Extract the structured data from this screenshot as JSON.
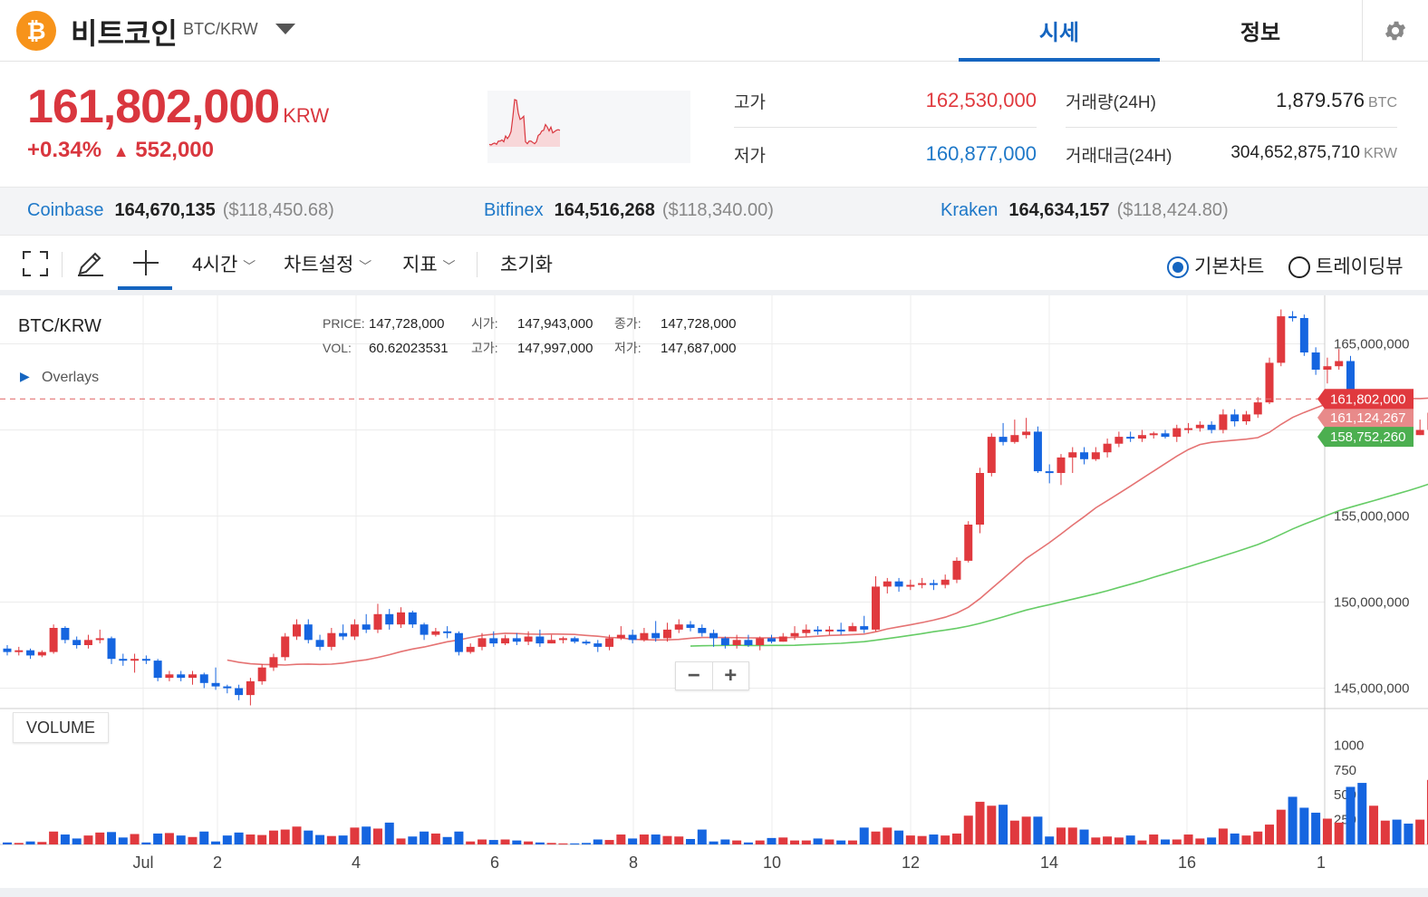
{
  "header": {
    "coin_symbol": "₿",
    "coin_name": "비트코인",
    "pair": "BTC/KRW",
    "tabs": [
      {
        "label": "시세",
        "active": true
      },
      {
        "label": "정보",
        "active": false
      }
    ]
  },
  "summary": {
    "price": "161,802,000",
    "price_unit": "KRW",
    "change_pct": "+0.34%",
    "change_abs": "552,000",
    "high_label": "고가",
    "high_value": "162,530,000",
    "low_label": "저가",
    "low_value": "160,877,000",
    "volume_label": "거래량(24H)",
    "volume_value": "1,879.576",
    "volume_unit": "BTC",
    "turnover_label": "거래대금(24H)",
    "turnover_value": "304,652,875,710",
    "turnover_unit": "KRW"
  },
  "exchanges": [
    {
      "name": "Coinbase",
      "krw": "164,670,135",
      "usd": "($118,450.68)"
    },
    {
      "name": "Bitfinex",
      "krw": "164,516,268",
      "usd": "($118,340.00)"
    },
    {
      "name": "Kraken",
      "krw": "164,634,157",
      "usd": "($118,424.80)"
    }
  ],
  "toolbar": {
    "interval": "4시간",
    "chart_settings": "차트설정",
    "indicators": "지표",
    "reset": "초기화",
    "basic_chart": "기본차트",
    "tradingview": "트레이딩뷰"
  },
  "colors": {
    "up": "#e0393e",
    "down": "#1565e0",
    "accent": "#1565c0",
    "ma_short": "#e57373",
    "ma_long": "#66cc66"
  },
  "chart_data": {
    "type": "candlestick",
    "pair_label": "BTC/KRW",
    "overlays_label": "Overlays",
    "info": {
      "price_label": "PRICE:",
      "price": "147,728,000",
      "open_label": "시가:",
      "open": "147,943,000",
      "close_label": "종가:",
      "close": "147,728,000",
      "vol_label": "VOL:",
      "vol": "60.62023531",
      "high_label": "고가:",
      "high": "147,997,000",
      "low_label": "저가:",
      "low": "147,687,000"
    },
    "x_ticks": [
      "Jul",
      "2",
      "4",
      "6",
      "8",
      "10",
      "12",
      "14",
      "16",
      "1"
    ],
    "y_ticks": [
      "165,000,000",
      "160,000,000",
      "155,000,000",
      "150,000,000",
      "145,000,000"
    ],
    "ylim": [
      143500000,
      167500000
    ],
    "current_price_label": "161,802,000",
    "ma_short_label": "161,124,267",
    "ma_long_label": "158,752,260",
    "volume_label": "VOLUME",
    "volume_ticks": [
      "1000",
      "750",
      "500",
      "250"
    ],
    "volume_ylim": [
      0,
      1150
    ],
    "candles": [
      [
        147300000,
        147100000,
        147500000,
        146900000,
        20
      ],
      [
        147100000,
        147200000,
        147400000,
        146900000,
        15
      ],
      [
        147200000,
        146900000,
        147300000,
        146700000,
        30
      ],
      [
        146900000,
        147100000,
        147200000,
        146800000,
        25
      ],
      [
        147100000,
        148500000,
        148700000,
        147000000,
        130
      ],
      [
        148500000,
        147800000,
        148600000,
        147600000,
        100
      ],
      [
        147800000,
        147500000,
        148000000,
        147300000,
        60
      ],
      [
        147500000,
        147800000,
        148100000,
        147300000,
        90
      ],
      [
        147800000,
        147900000,
        148400000,
        147600000,
        120
      ],
      [
        147900000,
        146700000,
        148000000,
        146400000,
        125
      ],
      [
        146700000,
        146600000,
        147000000,
        146300000,
        70
      ],
      [
        146600000,
        146700000,
        147000000,
        145900000,
        105
      ],
      [
        146700000,
        146600000,
        146900000,
        146400000,
        20
      ],
      [
        146600000,
        145600000,
        146700000,
        145400000,
        110
      ],
      [
        145600000,
        145800000,
        146000000,
        145400000,
        115
      ],
      [
        145800000,
        145600000,
        146000000,
        145400000,
        90
      ],
      [
        145600000,
        145800000,
        146000000,
        145200000,
        75
      ],
      [
        145800000,
        145300000,
        145900000,
        145000000,
        130
      ],
      [
        145300000,
        145100000,
        146200000,
        144900000,
        30
      ],
      [
        145100000,
        145000000,
        145200000,
        144700000,
        90
      ],
      [
        145000000,
        144600000,
        145200000,
        144300000,
        120
      ],
      [
        144600000,
        145400000,
        145600000,
        144000000,
        100
      ],
      [
        145400000,
        146200000,
        146400000,
        145200000,
        95
      ],
      [
        146200000,
        146800000,
        147000000,
        146000000,
        140
      ],
      [
        146800000,
        148000000,
        148200000,
        146600000,
        150
      ],
      [
        148000000,
        148700000,
        149000000,
        147800000,
        180
      ],
      [
        148700000,
        147800000,
        149000000,
        147600000,
        140
      ],
      [
        147800000,
        147400000,
        148100000,
        147200000,
        95
      ],
      [
        147400000,
        148200000,
        148500000,
        147200000,
        85
      ],
      [
        148200000,
        148000000,
        148700000,
        147800000,
        90
      ],
      [
        148000000,
        148700000,
        149000000,
        147800000,
        170
      ],
      [
        148700000,
        148400000,
        149300000,
        148200000,
        180
      ],
      [
        148400000,
        149300000,
        149900000,
        148200000,
        160
      ],
      [
        149300000,
        148700000,
        149600000,
        148400000,
        220
      ],
      [
        148700000,
        149400000,
        149700000,
        148500000,
        60
      ],
      [
        149400000,
        148700000,
        149500000,
        148500000,
        80
      ],
      [
        148700000,
        148100000,
        148800000,
        147800000,
        130
      ],
      [
        148100000,
        148300000,
        148500000,
        148000000,
        110
      ],
      [
        148300000,
        148200000,
        148600000,
        147900000,
        75
      ],
      [
        148200000,
        147100000,
        148300000,
        146900000,
        130
      ],
      [
        147100000,
        147400000,
        147600000,
        147000000,
        30
      ],
      [
        147400000,
        147900000,
        148200000,
        147200000,
        50
      ],
      [
        147900000,
        147600000,
        148300000,
        147400000,
        45
      ],
      [
        147600000,
        147900000,
        148100000,
        147500000,
        50
      ],
      [
        147900000,
        147700000,
        148200000,
        147500000,
        40
      ],
      [
        147700000,
        148000000,
        148300000,
        147500000,
        30
      ],
      [
        148000000,
        147600000,
        148400000,
        147400000,
        20
      ],
      [
        147600000,
        147800000,
        148100000,
        147600000,
        15
      ],
      [
        147800000,
        147900000,
        148000000,
        147600000,
        10
      ],
      [
        147900000,
        147700000,
        148000000,
        147600000,
        10
      ],
      [
        147700000,
        147600000,
        147800000,
        147500000,
        15
      ],
      [
        147600000,
        147400000,
        147800000,
        147100000,
        50
      ],
      [
        147400000,
        147900000,
        148100000,
        147200000,
        45
      ],
      [
        147900000,
        148100000,
        148600000,
        147800000,
        100
      ],
      [
        148100000,
        147800000,
        148400000,
        147600000,
        60
      ],
      [
        147800000,
        148200000,
        148500000,
        147700000,
        100
      ],
      [
        148200000,
        147900000,
        148900000,
        147700000,
        100
      ],
      [
        147900000,
        148400000,
        148800000,
        147700000,
        85
      ],
      [
        148400000,
        148700000,
        149000000,
        148200000,
        80
      ],
      [
        148700000,
        148500000,
        148900000,
        148300000,
        55
      ],
      [
        148500000,
        148200000,
        148700000,
        148000000,
        150
      ],
      [
        148200000,
        147900000,
        148400000,
        147400000,
        30
      ],
      [
        147900000,
        147500000,
        148000000,
        147300000,
        50
      ],
      [
        147500000,
        147800000,
        148100000,
        147300000,
        40
      ],
      [
        147800000,
        147500000,
        148100000,
        147400000,
        20
      ],
      [
        147500000,
        147900000,
        148000000,
        147200000,
        40
      ],
      [
        147900000,
        147700000,
        148100000,
        147600000,
        65
      ],
      [
        147700000,
        148000000,
        148200000,
        147700000,
        70
      ],
      [
        148000000,
        148200000,
        148600000,
        147800000,
        40
      ],
      [
        148200000,
        148400000,
        148700000,
        148000000,
        40
      ],
      [
        148400000,
        148300000,
        148600000,
        148100000,
        60
      ],
      [
        148300000,
        148400000,
        148600000,
        148100000,
        50
      ],
      [
        148400000,
        148300000,
        148800000,
        148100000,
        40
      ],
      [
        148300000,
        148600000,
        148800000,
        148300000,
        40
      ],
      [
        148600000,
        148400000,
        149200000,
        148200000,
        170
      ],
      [
        148400000,
        150900000,
        151500000,
        148300000,
        130
      ],
      [
        150900000,
        151200000,
        151400000,
        150500000,
        170
      ],
      [
        151200000,
        150900000,
        151400000,
        150600000,
        140
      ],
      [
        150900000,
        151000000,
        151300000,
        150700000,
        90
      ],
      [
        151000000,
        151100000,
        151400000,
        150800000,
        85
      ],
      [
        151100000,
        151000000,
        151300000,
        150700000,
        100
      ],
      [
        151000000,
        151300000,
        151600000,
        150800000,
        90
      ],
      [
        151300000,
        152400000,
        152600000,
        151100000,
        110
      ],
      [
        152400000,
        154500000,
        154700000,
        152300000,
        290
      ],
      [
        154500000,
        157500000,
        157800000,
        154000000,
        430
      ],
      [
        157500000,
        159600000,
        159800000,
        157300000,
        390
      ],
      [
        159600000,
        159300000,
        160400000,
        159100000,
        400
      ],
      [
        159300000,
        159700000,
        160600000,
        159200000,
        240
      ],
      [
        159700000,
        159900000,
        160700000,
        159500000,
        280
      ],
      [
        159900000,
        157600000,
        160200000,
        157500000,
        280
      ],
      [
        157600000,
        157500000,
        158000000,
        156900000,
        80
      ],
      [
        157500000,
        158400000,
        158600000,
        156800000,
        170
      ],
      [
        158400000,
        158700000,
        159000000,
        157500000,
        170
      ],
      [
        158700000,
        158300000,
        159000000,
        158000000,
        150
      ],
      [
        158300000,
        158700000,
        159000000,
        158200000,
        70
      ],
      [
        158700000,
        159200000,
        159500000,
        158400000,
        80
      ],
      [
        159200000,
        159600000,
        159900000,
        159000000,
        70
      ],
      [
        159600000,
        159500000,
        159900000,
        159300000,
        90
      ],
      [
        159500000,
        159700000,
        160000000,
        159300000,
        40
      ],
      [
        159700000,
        159800000,
        159900000,
        159500000,
        100
      ],
      [
        159800000,
        159600000,
        160000000,
        159500000,
        50
      ],
      [
        159600000,
        160100000,
        160300000,
        159300000,
        50
      ],
      [
        160100000,
        160100000,
        160400000,
        159800000,
        100
      ],
      [
        160100000,
        160300000,
        160500000,
        159900000,
        60
      ],
      [
        160300000,
        160000000,
        160500000,
        159800000,
        70
      ],
      [
        160000000,
        160900000,
        161200000,
        159800000,
        160
      ],
      [
        160900000,
        160500000,
        161200000,
        160200000,
        110
      ],
      [
        160500000,
        160900000,
        161100000,
        160300000,
        90
      ],
      [
        160900000,
        161600000,
        161900000,
        160700000,
        130
      ],
      [
        161600000,
        163900000,
        164200000,
        161500000,
        200
      ],
      [
        163900000,
        166600000,
        167000000,
        163700000,
        350
      ],
      [
        166600000,
        166500000,
        166900000,
        166300000,
        480
      ],
      [
        166500000,
        164500000,
        166700000,
        164300000,
        370
      ],
      [
        164500000,
        163500000,
        164800000,
        163200000,
        320
      ],
      [
        163500000,
        163700000,
        164200000,
        162700000,
        260
      ],
      [
        163700000,
        164000000,
        164700000,
        163500000,
        220
      ],
      [
        164000000,
        160000000,
        164300000,
        159900000,
        580
      ],
      [
        160000000,
        159700000,
        160800000,
        159300000,
        620
      ],
      [
        159700000,
        160100000,
        160700000,
        159400000,
        390
      ],
      [
        160100000,
        160100000,
        161100000,
        159500000,
        240
      ],
      [
        160100000,
        159900000,
        160900000,
        159500000,
        250
      ],
      [
        159900000,
        159700000,
        161100000,
        159400000,
        210
      ],
      [
        159700000,
        160000000,
        160600000,
        159700000,
        250
      ],
      [
        160000000,
        161000000,
        161300000,
        159700000,
        650
      ],
      [
        161000000,
        161200000,
        161600000,
        160600000,
        270
      ],
      [
        161200000,
        161700000,
        161800000,
        160700000,
        250
      ],
      [
        161700000,
        161800000,
        162000000,
        161500000,
        250
      ],
      [
        161800000,
        162700000,
        163100000,
        161700000,
        370
      ],
      [
        162700000,
        162300000,
        163100000,
        161900000,
        300
      ],
      [
        162300000,
        161700000,
        162700000,
        161500000,
        350
      ],
      [
        161700000,
        162300000,
        162800000,
        161300000,
        130
      ],
      [
        162300000,
        161400000,
        162900000,
        161000000,
        330
      ],
      [
        161400000,
        161600000,
        162200000,
        161200000,
        300
      ],
      [
        161600000,
        161800000,
        162000000,
        161300000,
        240
      ],
      [
        161800000,
        161900000,
        162000000,
        161500000,
        160
      ],
      [
        161900000,
        161800000,
        162000000,
        161600000,
        60
      ]
    ]
  }
}
